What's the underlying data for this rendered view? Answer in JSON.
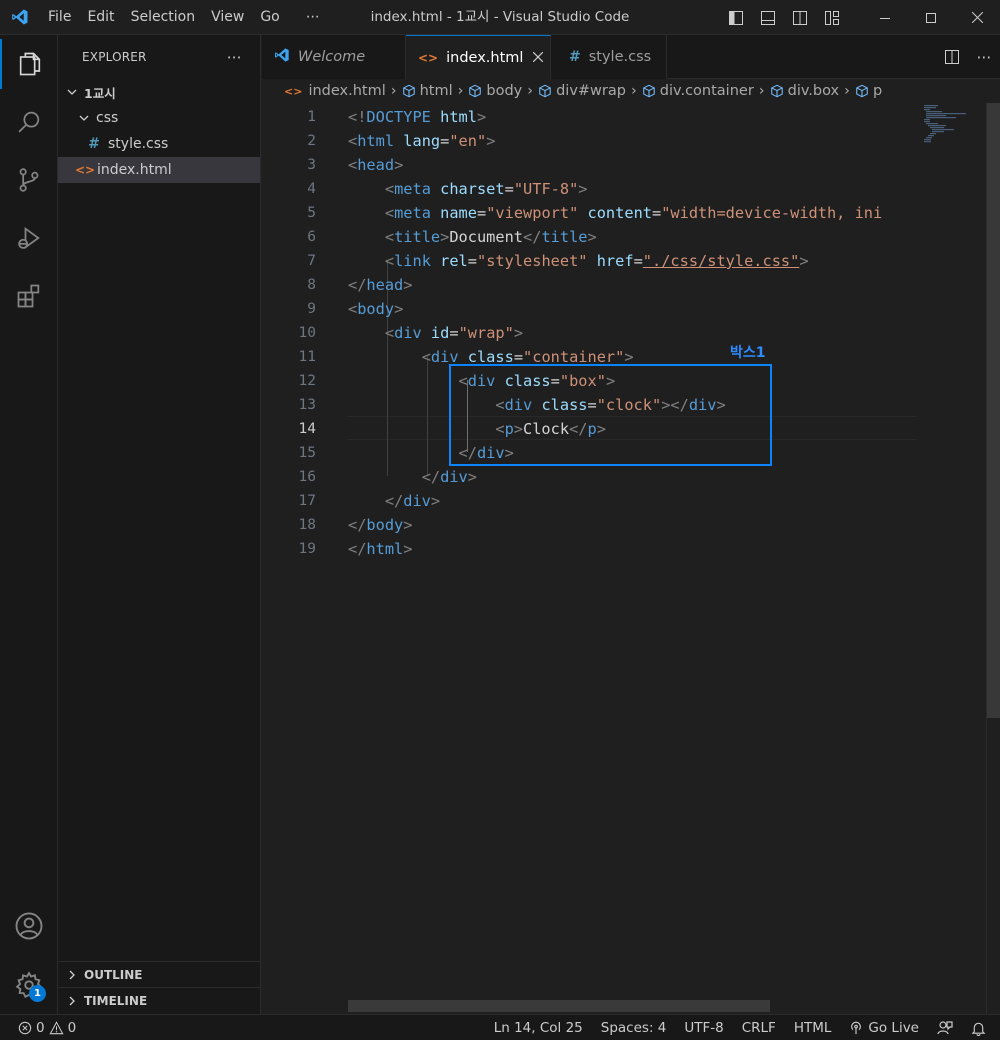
{
  "window": {
    "title": "index.html - 1교시 - Visual Studio Code",
    "menu": [
      "File",
      "Edit",
      "Selection",
      "View",
      "Go",
      "⋯"
    ]
  },
  "sidebar": {
    "header": "EXPLORER",
    "more": "⋯",
    "tree": [
      {
        "label": "1교시",
        "type": "folder"
      },
      {
        "label": "css",
        "type": "folder"
      },
      {
        "label": "style.css",
        "type": "css"
      },
      {
        "label": "index.html",
        "type": "html"
      }
    ],
    "sections": [
      "OUTLINE",
      "TIMELINE"
    ]
  },
  "tabs": [
    {
      "label": "Welcome"
    },
    {
      "label": "index.html"
    },
    {
      "label": "style.css"
    }
  ],
  "breadcrumb": [
    "index.html",
    "html",
    "body",
    "div#wrap",
    "div.container",
    "div.box",
    "p"
  ],
  "editor": {
    "current_line": 14,
    "lines": [
      [
        [
          "tp",
          "<!"
        ],
        [
          "tg",
          "DOCTYPE"
        ],
        [
          "tx",
          " "
        ],
        [
          "ta",
          "html"
        ],
        [
          "tp",
          ">"
        ]
      ],
      [
        [
          "tp",
          "<"
        ],
        [
          "tg",
          "html"
        ],
        [
          "tx",
          " "
        ],
        [
          "ta",
          "lang"
        ],
        [
          "tx",
          "="
        ],
        [
          "tv",
          "\"en\""
        ],
        [
          "tp",
          ">"
        ]
      ],
      [
        [
          "tp",
          "<"
        ],
        [
          "tg",
          "head"
        ],
        [
          "tp",
          ">"
        ]
      ],
      [
        [
          "tx",
          "    "
        ],
        [
          "tp",
          "<"
        ],
        [
          "tg",
          "meta"
        ],
        [
          "tx",
          " "
        ],
        [
          "ta",
          "charset"
        ],
        [
          "tx",
          "="
        ],
        [
          "tv",
          "\"UTF-8\""
        ],
        [
          "tp",
          ">"
        ]
      ],
      [
        [
          "tx",
          "    "
        ],
        [
          "tp",
          "<"
        ],
        [
          "tg",
          "meta"
        ],
        [
          "tx",
          " "
        ],
        [
          "ta",
          "name"
        ],
        [
          "tx",
          "="
        ],
        [
          "tv",
          "\"viewport\""
        ],
        [
          "tx",
          " "
        ],
        [
          "ta",
          "content"
        ],
        [
          "tx",
          "="
        ],
        [
          "tv",
          "\"width=device-width, ini"
        ]
      ],
      [
        [
          "tx",
          "    "
        ],
        [
          "tp",
          "<"
        ],
        [
          "tg",
          "title"
        ],
        [
          "tp",
          ">"
        ],
        [
          "tx",
          "Document"
        ],
        [
          "tp",
          "</"
        ],
        [
          "tg",
          "title"
        ],
        [
          "tp",
          ">"
        ]
      ],
      [
        [
          "tx",
          "    "
        ],
        [
          "tp",
          "<"
        ],
        [
          "tg",
          "link"
        ],
        [
          "tx",
          " "
        ],
        [
          "ta",
          "rel"
        ],
        [
          "tx",
          "="
        ],
        [
          "tv",
          "\"stylesheet\""
        ],
        [
          "tx",
          " "
        ],
        [
          "ta",
          "href"
        ],
        [
          "tx",
          "="
        ],
        [
          "tv",
          "\"./css/style.css\""
        ],
        [
          "tp",
          ">"
        ]
      ],
      [
        [
          "tp",
          "</"
        ],
        [
          "tg",
          "head"
        ],
        [
          "tp",
          ">"
        ]
      ],
      [
        [
          "tp",
          "<"
        ],
        [
          "tg",
          "body"
        ],
        [
          "tp",
          ">"
        ]
      ],
      [
        [
          "tx",
          "    "
        ],
        [
          "tp",
          "<"
        ],
        [
          "tg",
          "div"
        ],
        [
          "tx",
          " "
        ],
        [
          "ta",
          "id"
        ],
        [
          "tx",
          "="
        ],
        [
          "tv",
          "\"wrap\""
        ],
        [
          "tp",
          ">"
        ]
      ],
      [
        [
          "tx",
          "        "
        ],
        [
          "tp",
          "<"
        ],
        [
          "tg",
          "div"
        ],
        [
          "tx",
          " "
        ],
        [
          "ta",
          "class"
        ],
        [
          "tx",
          "="
        ],
        [
          "tv",
          "\"container\""
        ],
        [
          "tp",
          ">"
        ]
      ],
      [
        [
          "tx",
          "            "
        ],
        [
          "tp",
          "<"
        ],
        [
          "tg",
          "div"
        ],
        [
          "tx",
          " "
        ],
        [
          "ta",
          "class"
        ],
        [
          "tx",
          "="
        ],
        [
          "tv",
          "\"box\""
        ],
        [
          "tp",
          ">"
        ]
      ],
      [
        [
          "tx",
          "                "
        ],
        [
          "tp",
          "<"
        ],
        [
          "tg",
          "div"
        ],
        [
          "tx",
          " "
        ],
        [
          "ta",
          "class"
        ],
        [
          "tx",
          "="
        ],
        [
          "tv",
          "\"clock\""
        ],
        [
          "tp",
          "></"
        ],
        [
          "tg",
          "div"
        ],
        [
          "tp",
          ">"
        ]
      ],
      [
        [
          "tx",
          "                "
        ],
        [
          "tp",
          "<"
        ],
        [
          "tg",
          "p"
        ],
        [
          "tp",
          ">"
        ],
        [
          "tx",
          "Clock"
        ],
        [
          "tp",
          "</"
        ],
        [
          "tg",
          "p"
        ],
        [
          "tp",
          ">"
        ]
      ],
      [
        [
          "tx",
          "            "
        ],
        [
          "tp",
          "</"
        ],
        [
          "tg",
          "div"
        ],
        [
          "tp",
          ">"
        ]
      ],
      [
        [
          "tx",
          "        "
        ],
        [
          "tp",
          "</"
        ],
        [
          "tg",
          "div"
        ],
        [
          "tp",
          ">"
        ]
      ],
      [
        [
          "tx",
          "    "
        ],
        [
          "tp",
          "</"
        ],
        [
          "tg",
          "div"
        ],
        [
          "tp",
          ">"
        ]
      ],
      [
        [
          "tp",
          "</"
        ],
        [
          "tg",
          "body"
        ],
        [
          "tp",
          ">"
        ]
      ],
      [
        [
          "tp",
          "</"
        ],
        [
          "tg",
          "html"
        ],
        [
          "tp",
          ">"
        ]
      ]
    ],
    "annotation_label": "박스1"
  },
  "status": {
    "errors": "0",
    "warnings": "0",
    "position": "Ln 14, Col 25",
    "spaces": "Spaces: 4",
    "encoding": "UTF-8",
    "eol": "CRLF",
    "language": "HTML",
    "golive": "Go Live"
  },
  "settings_badge": "1",
  "colors": {
    "accent": "#0078d4",
    "annotation": "#0a84ff",
    "html_icon": "#e37933",
    "css_icon": "#519aba"
  }
}
